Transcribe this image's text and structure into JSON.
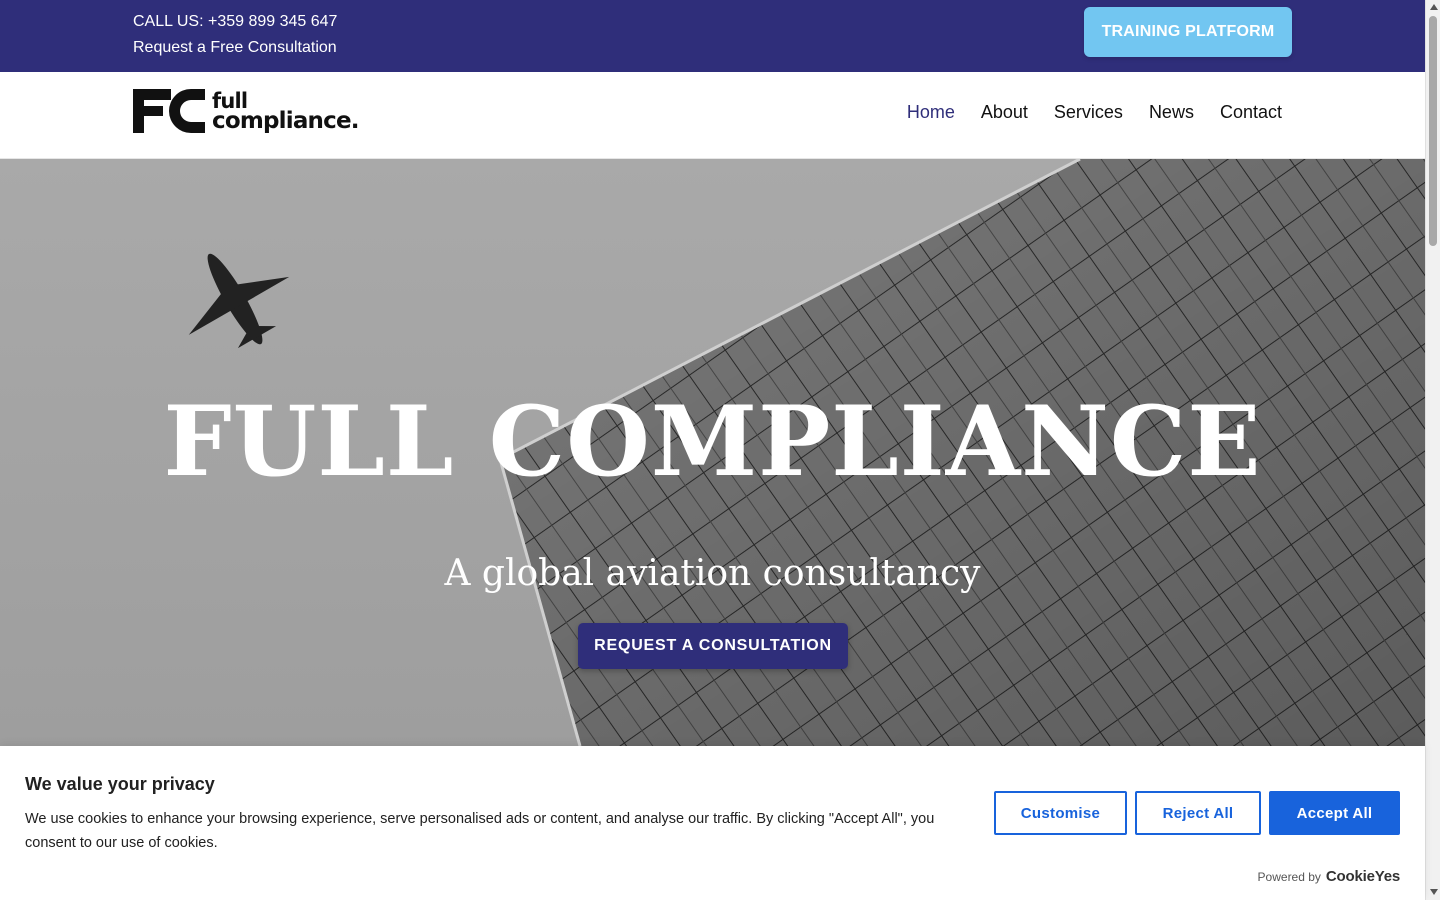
{
  "topbar": {
    "call_us": "CALL US: +359 899 345 647",
    "consultation_link": "Request a Free Consultation",
    "training_button": "TRAINING PLATFORM"
  },
  "header": {
    "logo_line1": "full",
    "logo_line2": "compliance.",
    "nav": [
      {
        "label": "Home",
        "active": true
      },
      {
        "label": "About",
        "active": false
      },
      {
        "label": "Services",
        "active": false
      },
      {
        "label": "News",
        "active": false
      },
      {
        "label": "Contact",
        "active": false
      }
    ]
  },
  "hero": {
    "title": "FULL COMPLIANCE",
    "subtitle": "A global aviation consultancy",
    "cta": "REQUEST A CONSULTATION"
  },
  "cookie_banner": {
    "title": "We value your privacy",
    "text": "We use cookies to enhance your browsing experience, serve personalised ads or content, and analyse our traffic. By clicking \"Accept All\", you consent to our use of cookies.",
    "customise": "Customise",
    "reject": "Reject All",
    "accept": "Accept All",
    "powered_by": "Powered by",
    "brand": "CookieYes"
  },
  "colors": {
    "brand_navy": "#2f2e7a",
    "training_blue": "#72c6f1",
    "cookie_blue": "#1863dc"
  }
}
